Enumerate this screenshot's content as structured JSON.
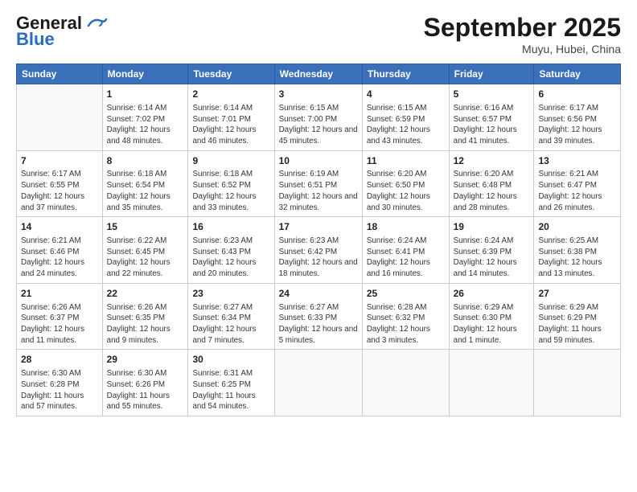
{
  "header": {
    "logo_line1": "General",
    "logo_line2": "Blue",
    "month": "September 2025",
    "location": "Muyu, Hubei, China"
  },
  "days_of_week": [
    "Sunday",
    "Monday",
    "Tuesday",
    "Wednesday",
    "Thursday",
    "Friday",
    "Saturday"
  ],
  "weeks": [
    [
      {
        "day": "",
        "info": ""
      },
      {
        "day": "1",
        "info": "Sunrise: 6:14 AM\nSunset: 7:02 PM\nDaylight: 12 hours and 48 minutes."
      },
      {
        "day": "2",
        "info": "Sunrise: 6:14 AM\nSunset: 7:01 PM\nDaylight: 12 hours and 46 minutes."
      },
      {
        "day": "3",
        "info": "Sunrise: 6:15 AM\nSunset: 7:00 PM\nDaylight: 12 hours and 45 minutes."
      },
      {
        "day": "4",
        "info": "Sunrise: 6:15 AM\nSunset: 6:59 PM\nDaylight: 12 hours and 43 minutes."
      },
      {
        "day": "5",
        "info": "Sunrise: 6:16 AM\nSunset: 6:57 PM\nDaylight: 12 hours and 41 minutes."
      },
      {
        "day": "6",
        "info": "Sunrise: 6:17 AM\nSunset: 6:56 PM\nDaylight: 12 hours and 39 minutes."
      }
    ],
    [
      {
        "day": "7",
        "info": "Sunrise: 6:17 AM\nSunset: 6:55 PM\nDaylight: 12 hours and 37 minutes."
      },
      {
        "day": "8",
        "info": "Sunrise: 6:18 AM\nSunset: 6:54 PM\nDaylight: 12 hours and 35 minutes."
      },
      {
        "day": "9",
        "info": "Sunrise: 6:18 AM\nSunset: 6:52 PM\nDaylight: 12 hours and 33 minutes."
      },
      {
        "day": "10",
        "info": "Sunrise: 6:19 AM\nSunset: 6:51 PM\nDaylight: 12 hours and 32 minutes."
      },
      {
        "day": "11",
        "info": "Sunrise: 6:20 AM\nSunset: 6:50 PM\nDaylight: 12 hours and 30 minutes."
      },
      {
        "day": "12",
        "info": "Sunrise: 6:20 AM\nSunset: 6:48 PM\nDaylight: 12 hours and 28 minutes."
      },
      {
        "day": "13",
        "info": "Sunrise: 6:21 AM\nSunset: 6:47 PM\nDaylight: 12 hours and 26 minutes."
      }
    ],
    [
      {
        "day": "14",
        "info": "Sunrise: 6:21 AM\nSunset: 6:46 PM\nDaylight: 12 hours and 24 minutes."
      },
      {
        "day": "15",
        "info": "Sunrise: 6:22 AM\nSunset: 6:45 PM\nDaylight: 12 hours and 22 minutes."
      },
      {
        "day": "16",
        "info": "Sunrise: 6:23 AM\nSunset: 6:43 PM\nDaylight: 12 hours and 20 minutes."
      },
      {
        "day": "17",
        "info": "Sunrise: 6:23 AM\nSunset: 6:42 PM\nDaylight: 12 hours and 18 minutes."
      },
      {
        "day": "18",
        "info": "Sunrise: 6:24 AM\nSunset: 6:41 PM\nDaylight: 12 hours and 16 minutes."
      },
      {
        "day": "19",
        "info": "Sunrise: 6:24 AM\nSunset: 6:39 PM\nDaylight: 12 hours and 14 minutes."
      },
      {
        "day": "20",
        "info": "Sunrise: 6:25 AM\nSunset: 6:38 PM\nDaylight: 12 hours and 13 minutes."
      }
    ],
    [
      {
        "day": "21",
        "info": "Sunrise: 6:26 AM\nSunset: 6:37 PM\nDaylight: 12 hours and 11 minutes."
      },
      {
        "day": "22",
        "info": "Sunrise: 6:26 AM\nSunset: 6:35 PM\nDaylight: 12 hours and 9 minutes."
      },
      {
        "day": "23",
        "info": "Sunrise: 6:27 AM\nSunset: 6:34 PM\nDaylight: 12 hours and 7 minutes."
      },
      {
        "day": "24",
        "info": "Sunrise: 6:27 AM\nSunset: 6:33 PM\nDaylight: 12 hours and 5 minutes."
      },
      {
        "day": "25",
        "info": "Sunrise: 6:28 AM\nSunset: 6:32 PM\nDaylight: 12 hours and 3 minutes."
      },
      {
        "day": "26",
        "info": "Sunrise: 6:29 AM\nSunset: 6:30 PM\nDaylight: 12 hours and 1 minute."
      },
      {
        "day": "27",
        "info": "Sunrise: 6:29 AM\nSunset: 6:29 PM\nDaylight: 11 hours and 59 minutes."
      }
    ],
    [
      {
        "day": "28",
        "info": "Sunrise: 6:30 AM\nSunset: 6:28 PM\nDaylight: 11 hours and 57 minutes."
      },
      {
        "day": "29",
        "info": "Sunrise: 6:30 AM\nSunset: 6:26 PM\nDaylight: 11 hours and 55 minutes."
      },
      {
        "day": "30",
        "info": "Sunrise: 6:31 AM\nSunset: 6:25 PM\nDaylight: 11 hours and 54 minutes."
      },
      {
        "day": "",
        "info": ""
      },
      {
        "day": "",
        "info": ""
      },
      {
        "day": "",
        "info": ""
      },
      {
        "day": "",
        "info": ""
      }
    ]
  ]
}
